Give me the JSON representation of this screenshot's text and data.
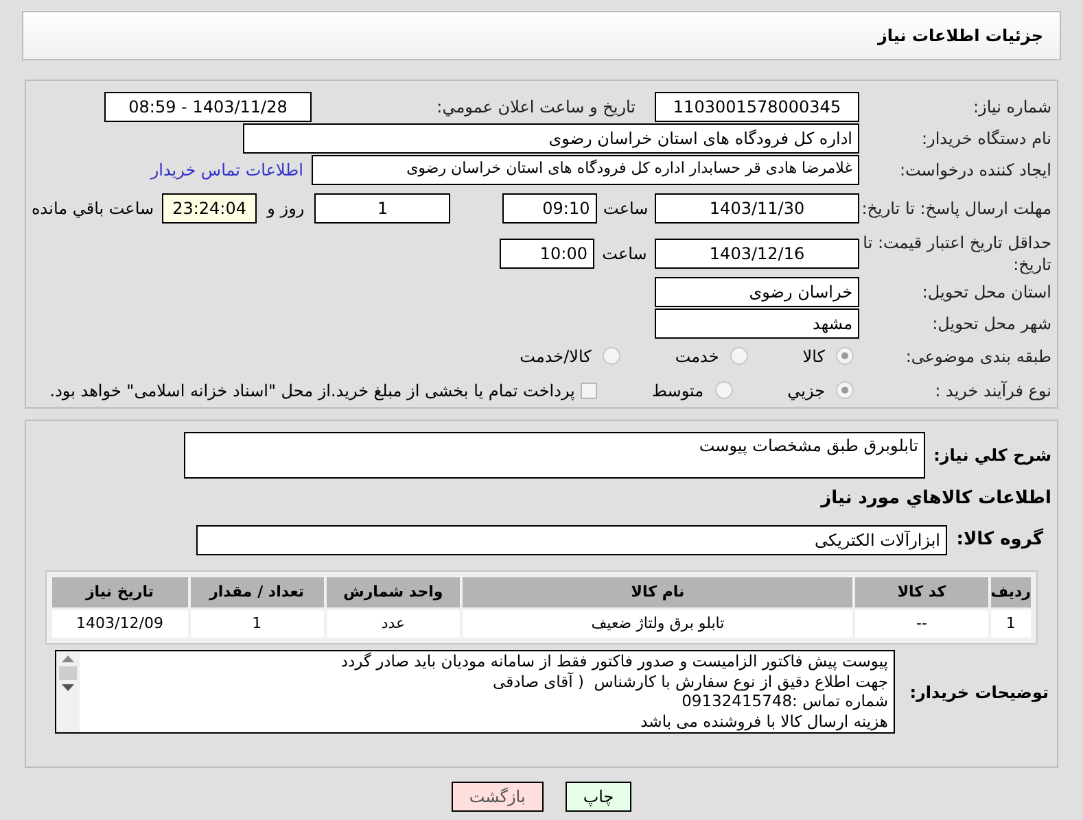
{
  "header": {
    "title": "جزئیات اطلاعات نیاز"
  },
  "info": {
    "need_number": {
      "label": "شماره نیاز:",
      "value": "1103001578000345"
    },
    "announce": {
      "label": "تاریخ و ساعت اعلان عمومي:",
      "value": "1403/11/28 - 08:59"
    },
    "buyer": {
      "label": "نام دستگاه خریدار:",
      "value": "اداره کل فرودگاه های استان خراسان رضوی"
    },
    "creator": {
      "label": "ایجاد کننده درخواست:",
      "value": "غلامرضا هادی قر حسابدار اداره کل فرودگاه های استان خراسان رضوی",
      "link": "اطلاعات تماس خریدار"
    },
    "deadline": {
      "label": "مهلت ارسال پاسخ: تا تاریخ:",
      "date": "1403/11/30",
      "time_label": "ساعت",
      "time": "09:10",
      "days": "1",
      "days_label": "روز و",
      "remaining": "23:24:04",
      "remaining_label": "ساعت باقي مانده"
    },
    "validity": {
      "label": "حداقل تاریخ اعتبار قیمت: تا تاریخ:",
      "date": "1403/12/16",
      "time_label": "ساعت",
      "time": "10:00"
    },
    "province": {
      "label": "استان محل تحویل:",
      "value": "خراسان رضوی"
    },
    "city": {
      "label": "شهر محل تحویل:",
      "value": "مشهد"
    },
    "category": {
      "label": "طبقه بندی موضوعی:",
      "options": [
        {
          "label": "کالا",
          "selected": true
        },
        {
          "label": "خدمت",
          "selected": false
        },
        {
          "label": "کالا/خدمت",
          "selected": false
        }
      ]
    },
    "process": {
      "label": "نوع فرآیند خرید :",
      "options": [
        {
          "label": "جزیي",
          "selected": true
        },
        {
          "label": "متوسط",
          "selected": false
        }
      ],
      "payment": {
        "checked": false,
        "text": "پرداخت تمام یا بخشی از مبلغ خرید.از محل \"اسناد خزانه اسلامی\" خواهد بود."
      }
    }
  },
  "details": {
    "description": {
      "label": "شرح کلي نیاز:",
      "value": "تابلوبرق طبق مشخصات پیوست"
    },
    "goods_title": "اطلاعات كالاهاي مورد نياز",
    "group": {
      "label": "گروه کالا:",
      "value": "ابزارآلات الکتریکی"
    },
    "table": {
      "columns": [
        "ردیف",
        "کد کالا",
        "نام کالا",
        "واحد شمارش",
        "تعداد / مقدار",
        "تاریخ نیاز"
      ],
      "rows": [
        [
          "1",
          "--",
          "تابلو برق ولتاژ ضعیف",
          "عدد",
          "1",
          "1403/12/09"
        ]
      ]
    },
    "notes": {
      "label": "توضیحات خریدار:",
      "lines": [
        "پیوست پیش فاکتور الزامیست و صدور فاکتور فقط از سامانه مودیان باید صادر گردد",
        "جهت اطلاع دقیق از نوع سفارش با کارشناس  ( آقای صادقی",
        "شماره تماس :09132415748",
        "هزینه ارسال کالا با فروشنده می باشد"
      ]
    }
  },
  "buttons": [
    {
      "kind": "print",
      "label": "چاپ"
    },
    {
      "kind": "back",
      "label": "بازگشت"
    }
  ]
}
